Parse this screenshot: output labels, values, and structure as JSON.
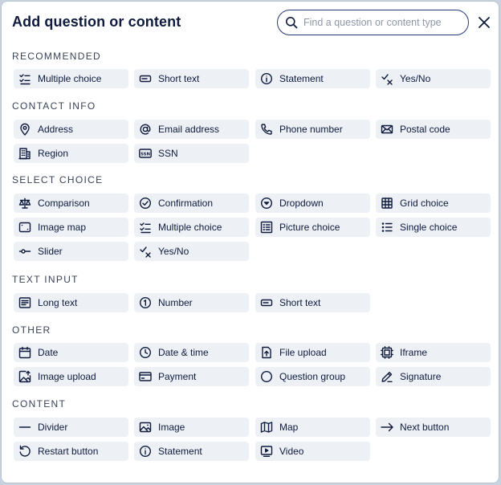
{
  "dialog": {
    "title": "Add question or content",
    "search_placeholder": "Find a question or content type",
    "search_value": ""
  },
  "sections": [
    {
      "title": "RECOMMENDED",
      "items": [
        {
          "label": "Multiple choice",
          "icon": "multiple-choice-icon"
        },
        {
          "label": "Short text",
          "icon": "short-text-icon"
        },
        {
          "label": "Statement",
          "icon": "info-icon"
        },
        {
          "label": "Yes/No",
          "icon": "yes-no-icon"
        }
      ]
    },
    {
      "title": "CONTACT INFO",
      "items": [
        {
          "label": "Address",
          "icon": "location-pin-icon"
        },
        {
          "label": "Email address",
          "icon": "at-sign-icon"
        },
        {
          "label": "Phone number",
          "icon": "phone-icon"
        },
        {
          "label": "Postal code",
          "icon": "envelope-icon"
        },
        {
          "label": "Region",
          "icon": "building-icon"
        },
        {
          "label": "SSN",
          "icon": "ssn-icon"
        }
      ]
    },
    {
      "title": "SELECT CHOICE",
      "items": [
        {
          "label": "Comparison",
          "icon": "scale-icon"
        },
        {
          "label": "Confirmation",
          "icon": "check-circle-icon"
        },
        {
          "label": "Dropdown",
          "icon": "dropdown-icon"
        },
        {
          "label": "Grid choice",
          "icon": "grid-icon"
        },
        {
          "label": "Image map",
          "icon": "image-map-icon"
        },
        {
          "label": "Multiple choice",
          "icon": "multiple-choice-icon"
        },
        {
          "label": "Picture choice",
          "icon": "picture-choice-icon"
        },
        {
          "label": "Single choice",
          "icon": "single-choice-icon"
        },
        {
          "label": "Slider",
          "icon": "slider-icon"
        },
        {
          "label": "Yes/No",
          "icon": "yes-no-icon"
        }
      ]
    },
    {
      "title": "TEXT INPUT",
      "items": [
        {
          "label": "Long text",
          "icon": "long-text-icon"
        },
        {
          "label": "Number",
          "icon": "number-icon"
        },
        {
          "label": "Short text",
          "icon": "short-text-icon"
        }
      ]
    },
    {
      "title": "OTHER",
      "items": [
        {
          "label": "Date",
          "icon": "calendar-icon"
        },
        {
          "label": "Date & time",
          "icon": "clock-icon"
        },
        {
          "label": "File upload",
          "icon": "file-upload-icon"
        },
        {
          "label": "Iframe",
          "icon": "iframe-icon"
        },
        {
          "label": "Image upload",
          "icon": "image-upload-icon"
        },
        {
          "label": "Payment",
          "icon": "payment-card-icon"
        },
        {
          "label": "Question group",
          "icon": "circle-icon"
        },
        {
          "label": "Signature",
          "icon": "pen-icon"
        }
      ]
    },
    {
      "title": "CONTENT",
      "items": [
        {
          "label": "Divider",
          "icon": "divider-icon"
        },
        {
          "label": "Image",
          "icon": "image-icon"
        },
        {
          "label": "Map",
          "icon": "map-icon"
        },
        {
          "label": "Next button",
          "icon": "arrow-right-icon"
        },
        {
          "label": "Restart button",
          "icon": "restart-icon"
        },
        {
          "label": "Statement",
          "icon": "info-icon"
        },
        {
          "label": "Video",
          "icon": "video-icon"
        }
      ]
    }
  ]
}
